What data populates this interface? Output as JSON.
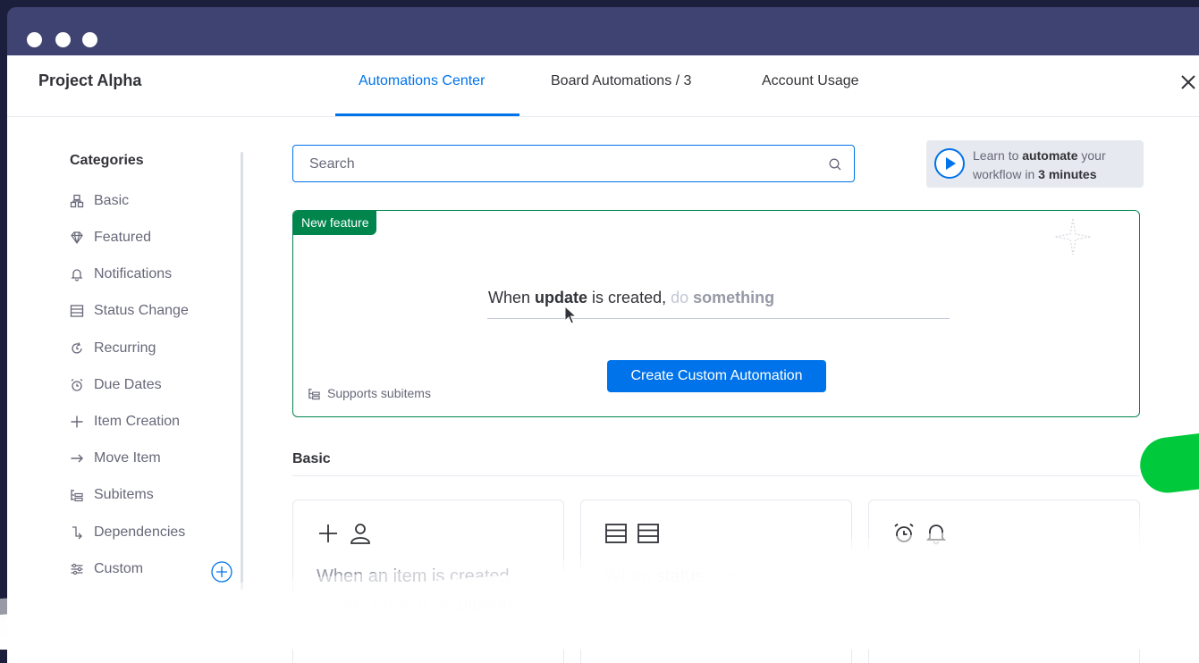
{
  "window": {
    "project_title": "Project Alpha",
    "tabs": [
      {
        "label": "Automations Center",
        "active": true
      },
      {
        "label": "Board Automations / 3",
        "active": false
      },
      {
        "label": "Account Usage",
        "active": false
      }
    ]
  },
  "sidebar": {
    "heading": "Categories",
    "items": [
      {
        "label": "Basic",
        "icon": "basic-icon"
      },
      {
        "label": "Featured",
        "icon": "diamond-icon"
      },
      {
        "label": "Notifications",
        "icon": "bell-icon"
      },
      {
        "label": "Status Change",
        "icon": "status-icon"
      },
      {
        "label": "Recurring",
        "icon": "recurring-icon"
      },
      {
        "label": "Due Dates",
        "icon": "alarm-icon"
      },
      {
        "label": "Item Creation",
        "icon": "plus-icon"
      },
      {
        "label": "Move Item",
        "icon": "arrow-right-icon"
      },
      {
        "label": "Subitems",
        "icon": "subitems-icon"
      },
      {
        "label": "Dependencies",
        "icon": "dependency-icon"
      },
      {
        "label": "Custom",
        "icon": "sliders-icon"
      }
    ]
  },
  "search": {
    "placeholder": "Search",
    "value": ""
  },
  "learn": {
    "text_1": "Learn to ",
    "bold_1": "automate",
    "text_2": " your workflow in ",
    "bold_2": "3 minutes"
  },
  "feature": {
    "badge": "New feature",
    "sentence": {
      "part1": "When ",
      "bold1": "update",
      "part2": " is created, ",
      "muted": "do ",
      "muted_bold": "something"
    },
    "button": "Create Custom Automation",
    "supports": "Supports subitems"
  },
  "section": {
    "title": "Basic"
  },
  "cards": [
    {
      "icons": [
        "plus-icon",
        "person-icon"
      ],
      "text_1": "When an item is created assign creator as ",
      "bold": "person"
    },
    {
      "icons": [
        "status-icon",
        "status-icon"
      ],
      "text_1": "When ",
      "bold": "status",
      "text_2": " chan"
    },
    {
      "icons": [
        "alarm-icon",
        "bell-icon"
      ],
      "text_1": ""
    }
  ],
  "colors": {
    "accent": "#0073ea",
    "feature_green": "#00854d",
    "titlebar": "#3f4371",
    "background": "#1c1f3b",
    "pill_green": "#00c93b"
  }
}
